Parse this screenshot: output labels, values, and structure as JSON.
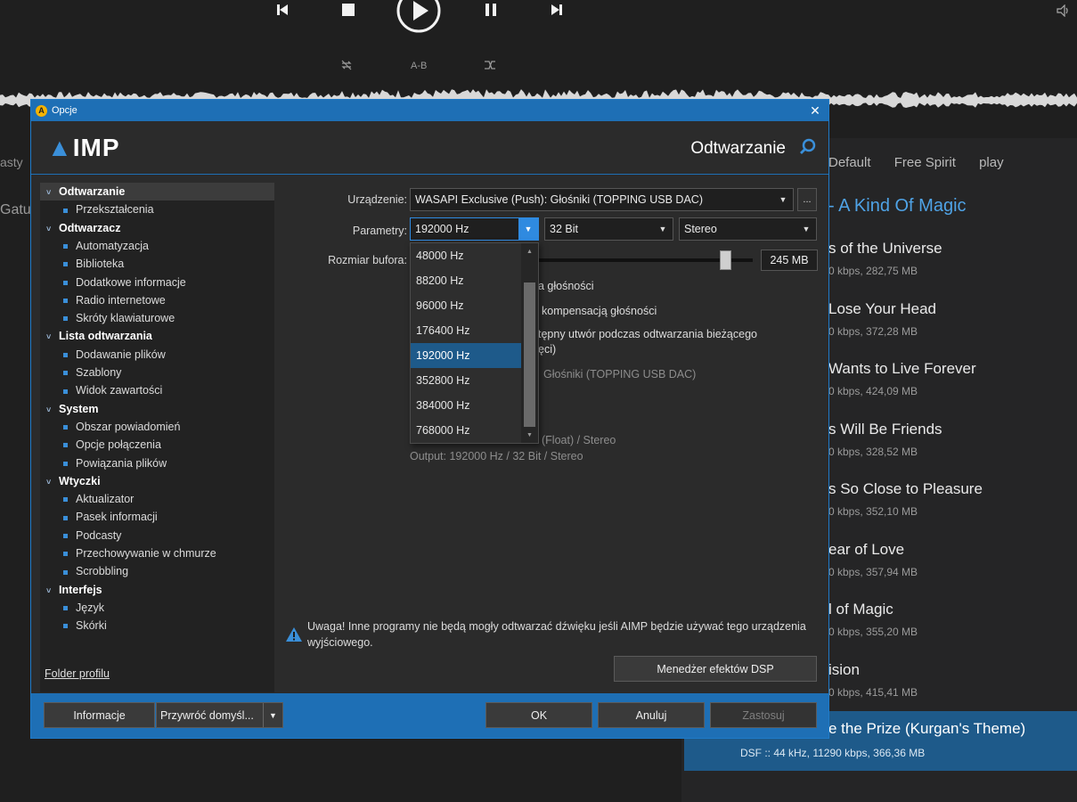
{
  "player": {
    "controls": [
      "prev-icon",
      "stop-icon",
      "play-icon",
      "pause-icon",
      "next-icon"
    ],
    "ab_label": "A-B"
  },
  "background": {
    "tabs": [
      "Default",
      "Free Spirit",
      "play"
    ],
    "left_fragment_1": "asty",
    "left_fragment_2": "Gatu",
    "album_title": "- A Kind Of Magic",
    "tracks": [
      {
        "title": "s of the Universe",
        "sub": "0 kbps, 282,75 MB"
      },
      {
        "title": "Lose Your Head",
        "sub": "0 kbps, 372,28 MB"
      },
      {
        "title": "Wants to Live Forever",
        "sub": "0 kbps, 424,09 MB"
      },
      {
        "title": "s Will Be Friends",
        "sub": "0 kbps, 328,52 MB"
      },
      {
        "title": "s So Close to Pleasure",
        "sub": "0 kbps, 352,10 MB"
      },
      {
        "title": "ear of Love",
        "sub": "0 kbps, 357,94 MB"
      },
      {
        "title": "l of Magic",
        "sub": "0 kbps, 355,20 MB"
      },
      {
        "title": "ision",
        "sub": "0 kbps, 415,41 MB"
      }
    ],
    "selected_track": {
      "title": "e the Prize (Kurgan's Theme)",
      "sub": "DSF :: 44 kHz, 11290 kbps, 366,36 MB"
    }
  },
  "dialog": {
    "title": "Opcje",
    "logo": "IMP",
    "section_title": "Odtwarzanie",
    "tree": [
      {
        "label": "Odtwarzanie",
        "type": "cat",
        "active": true
      },
      {
        "label": "Przekształcenia",
        "type": "sub"
      },
      {
        "label": "Odtwarzacz",
        "type": "cat"
      },
      {
        "label": "Automatyzacja",
        "type": "sub"
      },
      {
        "label": "Biblioteka",
        "type": "sub"
      },
      {
        "label": "Dodatkowe informacje",
        "type": "sub"
      },
      {
        "label": "Radio internetowe",
        "type": "sub"
      },
      {
        "label": "Skróty klawiaturowe",
        "type": "sub"
      },
      {
        "label": "Lista odtwarzania",
        "type": "cat"
      },
      {
        "label": "Dodawanie plików",
        "type": "sub"
      },
      {
        "label": "Szablony",
        "type": "sub"
      },
      {
        "label": "Widok zawartości",
        "type": "sub"
      },
      {
        "label": "System",
        "type": "cat"
      },
      {
        "label": "Obszar powiadomień",
        "type": "sub"
      },
      {
        "label": "Opcje połączenia",
        "type": "sub"
      },
      {
        "label": "Powiązania plików",
        "type": "sub"
      },
      {
        "label": "Wtyczki",
        "type": "cat"
      },
      {
        "label": "Aktualizator",
        "type": "sub"
      },
      {
        "label": "Pasek informacji",
        "type": "sub"
      },
      {
        "label": "Podcasty",
        "type": "sub"
      },
      {
        "label": "Przechowywanie w chmurze",
        "type": "sub"
      },
      {
        "label": "Scrobbling",
        "type": "sub"
      },
      {
        "label": "Interfejs",
        "type": "cat"
      },
      {
        "label": "Język",
        "type": "sub"
      },
      {
        "label": "Skórki",
        "type": "sub"
      }
    ],
    "folder_link": "Folder profilu",
    "device_label": "Urządzenie:",
    "device_value": "WASAPI Exclusive (Push): Głośniki (TOPPING USB DAC)",
    "device_more": "...",
    "params_label": "Parametry:",
    "freq_value": "192000 Hz",
    "bits_value": "32 Bit",
    "channels_value": "Stereo",
    "buffer_label": "Rozmiar bufora:",
    "buffer_value": "245 MB",
    "buffer_fraction": 0.92,
    "freq_options": [
      "48000 Hz",
      "88200 Hz",
      "96000 Hz",
      "176400 Hz",
      "192000 Hz",
      "352800 Hz",
      "384000 Hz",
      "768000 Hz"
    ],
    "freq_selected_index": 4,
    "hidden_opt_1": "a głośności",
    "hidden_opt_2": "kompensacją głośności",
    "hidden_opt_3a": "tępny utwór podczas odtwarzania bieżącego",
    "hidden_opt_3b": "ęci)",
    "hidden_device": "Głośniki (TOPPING USB DAC)",
    "info_input": "(Float) / Stereo",
    "info_output": "Output: 192000 Hz / 32 Bit / Stereo",
    "warning": "Uwaga! Inne programy nie będą mogły odtwarzać dźwięku jeśli AIMP będzie używać tego urządzenia wyjściowego.",
    "dsp_button": "Menedżer efektów DSP",
    "btn_info": "Informacje",
    "btn_restore": "Przywróć domyśl...",
    "btn_ok": "OK",
    "btn_cancel": "Anuluj",
    "btn_apply": "Zastosuj"
  }
}
